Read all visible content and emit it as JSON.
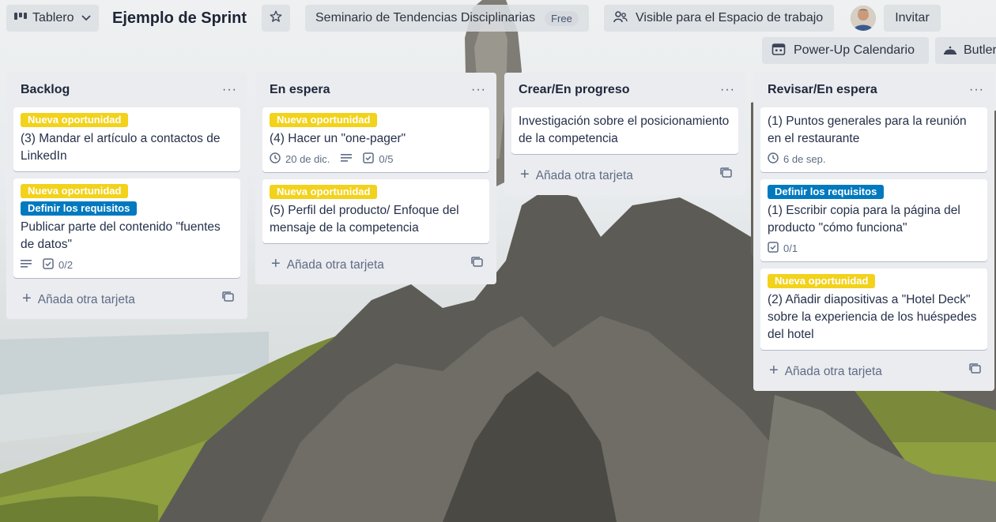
{
  "header": {
    "view_label": "Tablero",
    "board_title": "Ejemplo de Sprint",
    "workspace_name": "Seminario de Tendencias Disciplinarias",
    "plan_badge": "Free",
    "visibility_label": "Visible para el Espacio de trabajo",
    "invite_label": "Invitar",
    "calendar_powerup_label": "Power-Up Calendario",
    "butler_label": "Butler"
  },
  "add_card_label": "Añada otra tarjeta",
  "label_colors": {
    "yellow": "#f2d21b",
    "blue": "#0079bf"
  },
  "lists": [
    {
      "title": "Backlog",
      "cards": [
        {
          "labels": [
            "Nueva oportunidad"
          ],
          "title": "(3) Mandar el artículo a contactos de LinkedIn"
        },
        {
          "labels": [
            "Nueva oportunidad",
            "Definir los requisitos"
          ],
          "title": "Publicar parte del contenido \"fuentes de datos\"",
          "checklist": "0/2"
        }
      ]
    },
    {
      "title": "En espera",
      "cards": [
        {
          "labels": [
            "Nueva oportunidad"
          ],
          "title": "(4) Hacer un \"one-pager\"",
          "due": "20 de dic.",
          "checklist": "0/5"
        },
        {
          "labels": [
            "Nueva oportunidad"
          ],
          "title": "(5) Perfil del producto/ Enfoque del mensaje de la competencia"
        }
      ]
    },
    {
      "title": "Crear/En progreso",
      "cards": [
        {
          "title": "Investigación sobre el posicionamiento de la competencia"
        }
      ]
    },
    {
      "title": "Revisar/En espera",
      "cards": [
        {
          "title": "(1) Puntos generales para la reunión en el restaurante",
          "due": "6 de sep."
        },
        {
          "labels": [
            "Definir los requisitos"
          ],
          "title": "(1) Escribir copia para la página del producto \"cómo funciona\"",
          "checklist": "0/1"
        },
        {
          "labels": [
            "Nueva oportunidad"
          ],
          "title": "(2) Añadir diapositivas a \"Hotel Deck\" sobre la experiencia de los huéspedes del hotel"
        }
      ]
    }
  ]
}
